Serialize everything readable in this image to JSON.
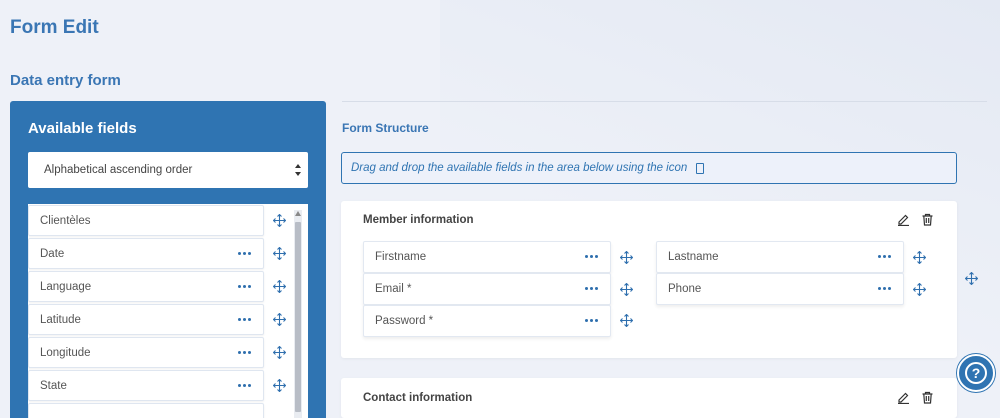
{
  "page": {
    "title": "Form Edit",
    "section": "Data entry form"
  },
  "available": {
    "title": "Available fields",
    "sort_selected": "Alphabetical ascending order",
    "fields": [
      {
        "label": "Clientèles",
        "has_menu": false
      },
      {
        "label": "Date",
        "has_menu": true
      },
      {
        "label": "Language",
        "has_menu": true
      },
      {
        "label": "Latitude",
        "has_menu": true
      },
      {
        "label": "Longitude",
        "has_menu": true
      },
      {
        "label": "State",
        "has_menu": true
      }
    ]
  },
  "structure": {
    "title": "Form Structure",
    "hint": "Drag and drop the available fields in the area below using the icon",
    "groups": [
      {
        "title": "Member information",
        "left_fields": [
          "Firstname",
          "Email *",
          "Password *"
        ],
        "right_fields": [
          "Lastname",
          "Phone"
        ]
      },
      {
        "title": "Contact information"
      }
    ]
  },
  "help": {
    "label": "?"
  },
  "colors": {
    "accent": "#2f74b2",
    "title": "#3a76b4",
    "background": "#eef1f8"
  }
}
